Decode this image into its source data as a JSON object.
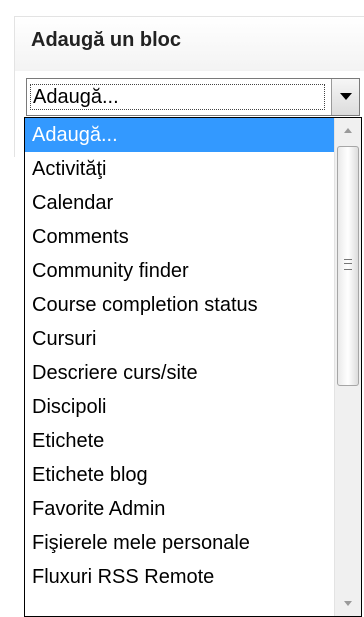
{
  "block": {
    "title": "Adaugă un bloc"
  },
  "select": {
    "value": "Adaugă..."
  },
  "dropdown": {
    "options": [
      "Adaugă...",
      "Activităţi",
      "Calendar",
      "Comments",
      "Community finder",
      "Course completion status",
      "Cursuri",
      "Descriere curs/site",
      "Discipoli",
      "Etichete",
      "Etichete blog",
      "Favorite Admin",
      "Fişierele mele personale",
      "Fluxuri RSS Remote"
    ],
    "selected_index": 0
  },
  "colors": {
    "selection": "#3399ff",
    "border": "#000000"
  }
}
